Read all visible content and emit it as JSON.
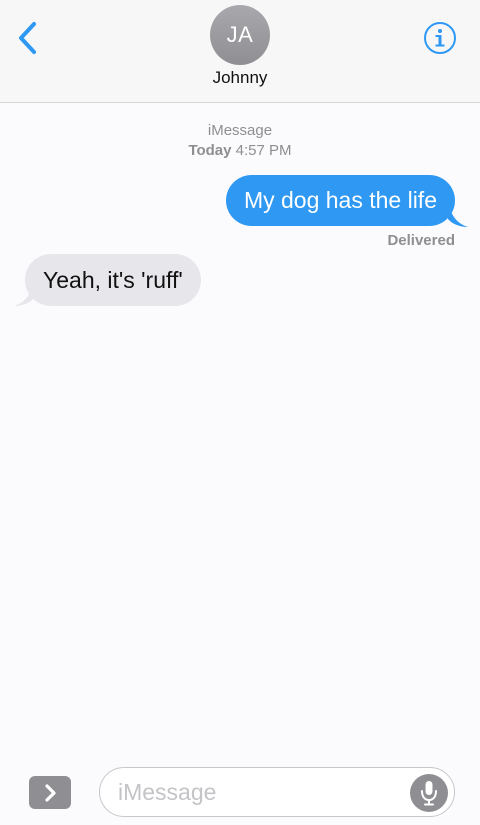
{
  "header": {
    "back_icon": "chevron-left-icon",
    "avatar_initials": "JA",
    "contact_name": "Johnny",
    "info_icon": "info-circle-icon"
  },
  "conversation": {
    "service": "iMessage",
    "timestamp_day": "Today",
    "timestamp_time": "4:57 PM",
    "messages": [
      {
        "direction": "outgoing",
        "text": "My dog has the life",
        "status": "Delivered"
      },
      {
        "direction": "incoming",
        "text": "Yeah, it's 'ruff'"
      }
    ]
  },
  "composer": {
    "apps_icon": "chevron-right-icon",
    "placeholder": "iMessage",
    "value": "",
    "mic_icon": "microphone-icon"
  },
  "colors": {
    "accent": "#2e98f3",
    "outgoing_bubble": "#2e98f3",
    "incoming_bubble": "#e6e6eb",
    "secondary_text": "#8e8e93"
  }
}
